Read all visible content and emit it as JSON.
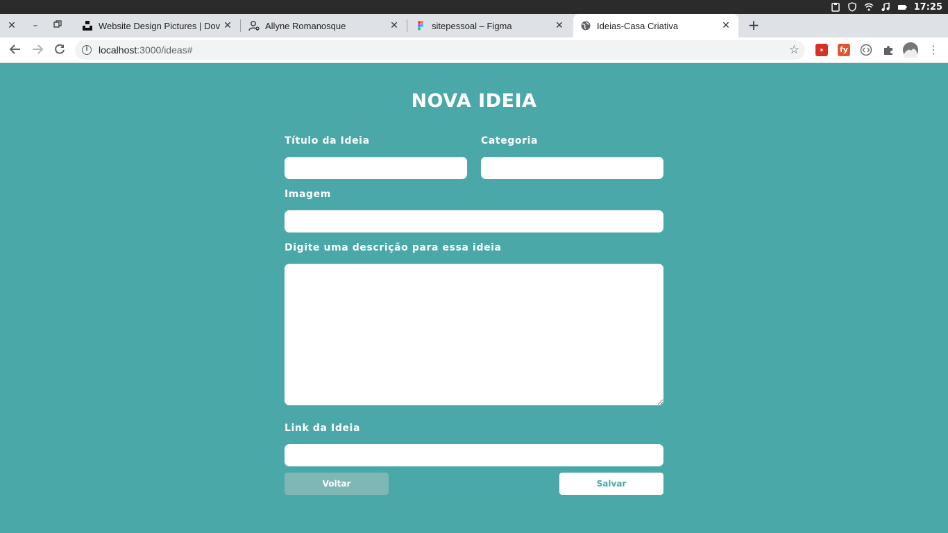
{
  "os": {
    "clock": "17:25",
    "icons": [
      "apple-icon",
      "clipboard-icon",
      "shield-icon",
      "wifi-icon",
      "music-icon",
      "battery-icon"
    ]
  },
  "tabs": [
    {
      "title": "Website Design Pictures | Dov",
      "icon": "unsplash-icon",
      "active": false
    },
    {
      "title": "Allyne Romanosque",
      "icon": "person-icon",
      "active": false
    },
    {
      "title": "sitepessoal – Figma",
      "icon": "figma-icon",
      "active": false
    },
    {
      "title": "Ideias-Casa Criativa",
      "icon": "globe-icon",
      "active": true
    }
  ],
  "address": {
    "host": "localhost",
    "path": ":3000/ideas#"
  },
  "extensions": [
    "youtube-ext-icon",
    "fy-ext-icon",
    "code-ext-icon",
    "puzzle-icon",
    "profile-avatar"
  ],
  "form": {
    "title": "NOVA IDEIA",
    "title_label": "Título da Ideia",
    "title_value": "",
    "category_label": "Categoria",
    "category_value": "",
    "image_label": "Imagem",
    "image_value": "",
    "description_label": "Digite uma descrição para essa ideia",
    "description_value": "",
    "link_label": "Link da Ideia",
    "link_value": "",
    "back_label": "Voltar",
    "save_label": "Salvar"
  },
  "colors": {
    "background": "#4aa8a8",
    "back_button": "#7fb6b6",
    "save_text": "#4aa8a8"
  }
}
